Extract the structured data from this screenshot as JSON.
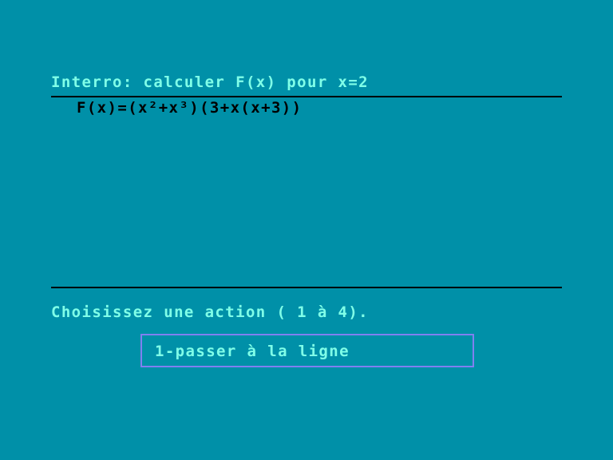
{
  "screen": {
    "title": "Interro: calculer F(x) pour x=2",
    "formula": "F(x)=(x²+x³)(3+x(x+3))",
    "prompt": "Choisissez une action ( 1 à 4).",
    "action": {
      "label": "1-passer à la ligne"
    }
  },
  "colors": {
    "background": "#0090a8",
    "text": "#80ffe8",
    "formula": "#000000",
    "rule": "#000000",
    "action_border": "#8080f0"
  }
}
